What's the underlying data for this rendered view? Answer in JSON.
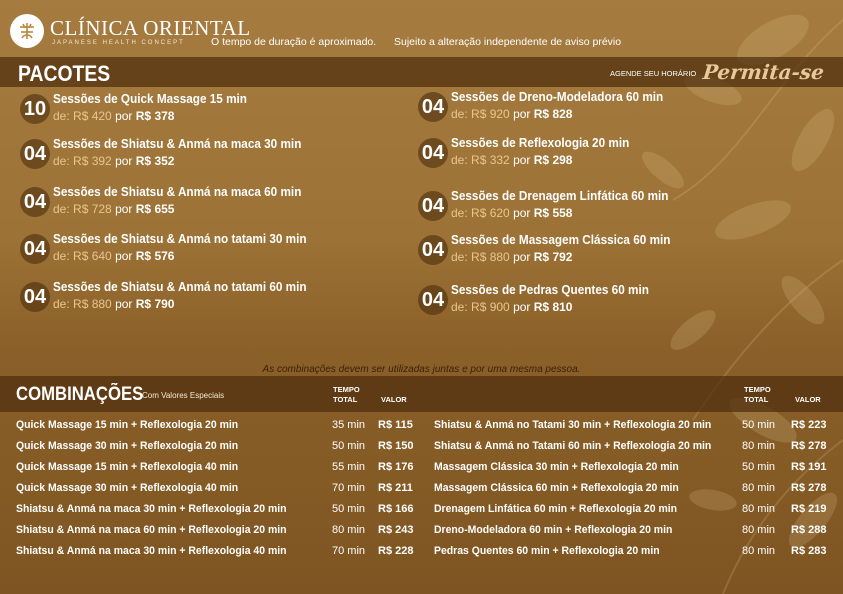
{
  "header": {
    "brand_name": "CLÍNICA ORIENTAL",
    "brand_sub": "JAPANESE HEALTH CONCEPT",
    "note_duration": "O tempo de duração é aproximado.",
    "note_change": "Sujeito a alteração independente de aviso prévio"
  },
  "pacotes": {
    "title": "PACOTES",
    "agende": "AGENDE SEU HORÁRIO",
    "slogan": "Permita-se",
    "de_label": "de:",
    "por_label": "por",
    "items": [
      {
        "qty": "10",
        "name": "Sessões de Quick Massage 15 min",
        "de": "R$ 420",
        "por": "R$ 378"
      },
      {
        "qty": "04",
        "name": "Sessões de Shiatsu & Anmá na maca 30 min",
        "de": "R$ 392",
        "por": "R$ 352"
      },
      {
        "qty": "04",
        "name": "Sessões de Shiatsu & Anmá na maca 60 min",
        "de": "R$ 728",
        "por": "R$ 655"
      },
      {
        "qty": "04",
        "name": "Sessões de Shiatsu & Anmá no tatami 30 min",
        "de": "R$ 640",
        "por": "R$ 576"
      },
      {
        "qty": "04",
        "name": "Sessões de Shiatsu & Anmá no tatami 60 min",
        "de": "R$ 880",
        "por": "R$ 790"
      },
      {
        "qty": "04",
        "name": "Sessões de Dreno-Modeladora 60 min",
        "de": "R$ 920",
        "por": "R$ 828"
      },
      {
        "qty": "04",
        "name": "Sessões de Reflexologia 20 min",
        "de": "R$ 332",
        "por": "R$ 298"
      },
      {
        "qty": "04",
        "name": "Sessões de Drenagem Linfática 60 min",
        "de": "R$ 620",
        "por": "R$ 558"
      },
      {
        "qty": "04",
        "name": "Sessões de Massagem Clássica 60 min",
        "de": "R$ 880",
        "por": "R$ 792"
      },
      {
        "qty": "04",
        "name": "Sessões de Pedras Quentes 60 min",
        "de": "R$ 900",
        "por": "R$ 810"
      }
    ]
  },
  "combo_note": "As combinações devem ser utilizadas juntas e por uma mesma pessoa.",
  "combinacoes": {
    "title": "COMBINAÇÕES",
    "subtitle": "Com Valores Especiais",
    "col_time_1": "TEMPO",
    "col_time_2": "TOTAL",
    "col_value": "VALOR",
    "left": [
      {
        "name": "Quick Massage 15 min + Reflexologia 20 min",
        "time": "35 min",
        "value": "R$ 115"
      },
      {
        "name": "Quick Massage 30 min + Reflexologia 20 min",
        "time": "50 min",
        "value": "R$ 150"
      },
      {
        "name": "Quick Massage 15 min + Reflexologia 40 min",
        "time": "55 min",
        "value": "R$ 176"
      },
      {
        "name": "Quick Massage 30 min + Reflexologia 40 min",
        "time": "70 min",
        "value": "R$ 211"
      },
      {
        "name": "Shiatsu & Anmá na maca 30 min + Reflexologia 20 min",
        "time": "50 min",
        "value": "R$ 166"
      },
      {
        "name": "Shiatsu & Anmá na maca 60 min + Reflexologia 20 min",
        "time": "80 min",
        "value": "R$ 243"
      },
      {
        "name": "Shiatsu & Anmá na maca 30 min + Reflexologia 40 min",
        "time": "70 min",
        "value": "R$ 228"
      }
    ],
    "right": [
      {
        "name": "Shiatsu & Anmá no Tatami 30 min + Reflexologia 20 min",
        "time": "50 min",
        "value": "R$ 223"
      },
      {
        "name": "Shiatsu & Anmá no Tatami 60 min + Reflexologia 20 min",
        "time": "80 min",
        "value": "R$ 278"
      },
      {
        "name": "Massagem Clássica 30 min + Reflexologia 20 min",
        "time": "50 min",
        "value": "R$ 191"
      },
      {
        "name": "Massagem Clássica 60 min + Reflexologia 20 min",
        "time": "80 min",
        "value": "R$ 278"
      },
      {
        "name": "Drenagem Linfática 60 min + Reflexologia 20 min",
        "time": "80 min",
        "value": "R$ 219"
      },
      {
        "name": "Dreno-Modeladora 60 min + Reflexologia 20 min",
        "time": "80 min",
        "value": "R$ 288"
      },
      {
        "name": "Pedras Quentes 60 min + Reflexologia 20 min",
        "time": "80 min",
        "value": "R$ 283"
      }
    ]
  }
}
